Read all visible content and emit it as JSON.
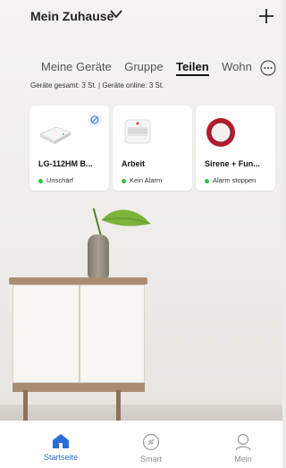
{
  "header": {
    "home_title": "Mein Zuhause"
  },
  "tabs": [
    {
      "label": "Meine Geräte",
      "active": false
    },
    {
      "label": "Gruppe",
      "active": false
    },
    {
      "label": "Teilen",
      "active": true
    },
    {
      "label": "Wohn",
      "active": false
    }
  ],
  "stats_text": "Geräte gesamt: 3 St. | Geräte online: 3 St.",
  "devices": [
    {
      "name": "LG-112HM B...",
      "status": "Unschärf",
      "icon": "hub-device-icon",
      "shared": true
    },
    {
      "name": "Arbeit",
      "status": "Kein Alarm",
      "icon": "smoke-detector-icon",
      "shared": false
    },
    {
      "name": "Sirene + Fun...",
      "status": "Alarm stoppen",
      "icon": "siren-icon",
      "shared": false
    }
  ],
  "bottom_nav": [
    {
      "label": "Startseite",
      "icon": "home-icon",
      "active": true
    },
    {
      "label": "Smart",
      "icon": "smart-icon",
      "active": false
    },
    {
      "label": "Mein",
      "icon": "profile-icon",
      "active": false
    }
  ],
  "colors": {
    "accent": "#2a6bd6",
    "online_dot": "#2ec24a",
    "siren_red": "#b01c2e"
  }
}
